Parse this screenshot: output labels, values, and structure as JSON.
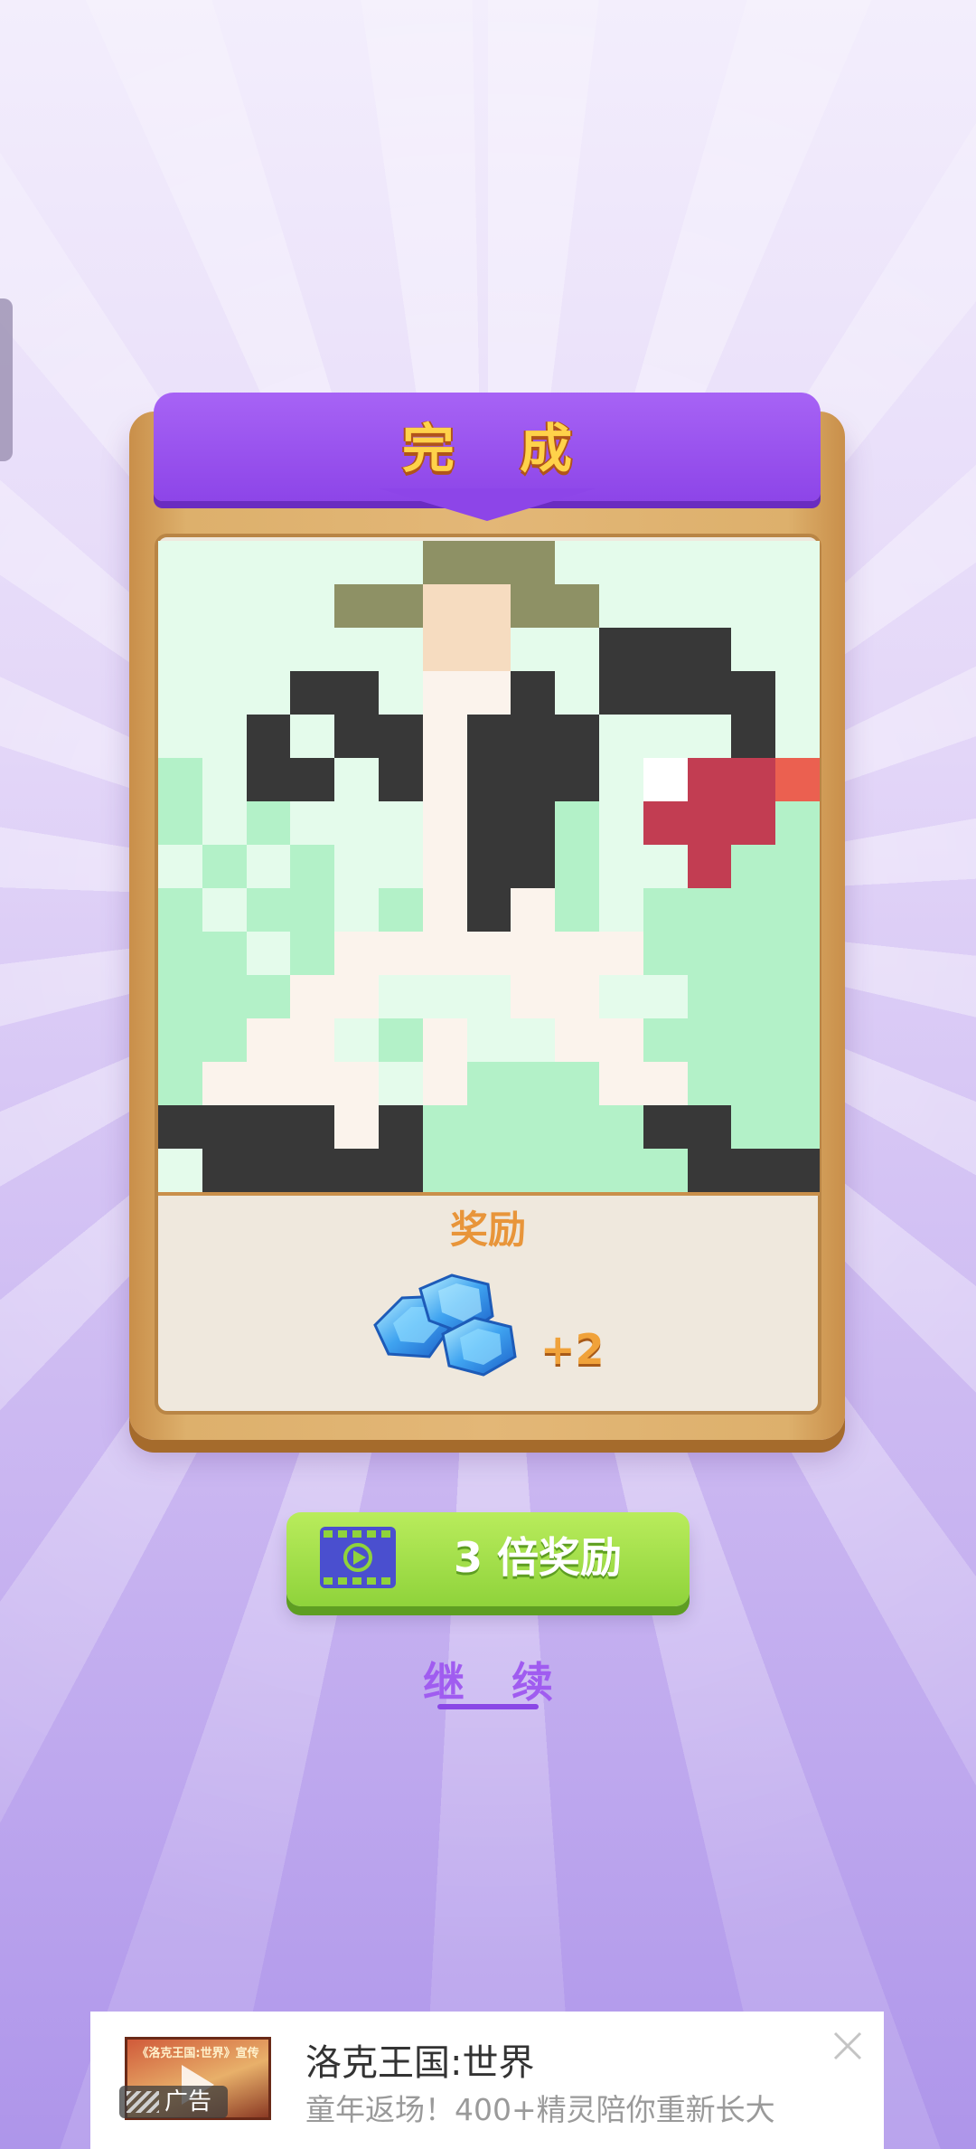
{
  "dialog": {
    "title": "完 成",
    "reward_label": "奖励",
    "reward_count": "+2"
  },
  "pixel_art": {
    "palette": {
      "0": "#e4fbeb",
      "1": "#b3f1c8",
      "2": "#383838",
      "3": "#fbf3ec",
      "4": "#8e9165",
      "5": "#f6dcc0",
      "6": "#c23d52",
      "7": "#eb6050",
      "8": "#ffffff"
    },
    "rows": [
      "000000444000000",
      "000044554400000",
      "000000550022200",
      "000220332022220",
      "002022322200020",
      "102202322208667",
      "101000322106661",
      "010100322100611",
      "101101323101111",
      "110133333331111",
      "111330003300111",
      "113301300331111",
      "133330311133111",
      "222232111112211",
      "022222111111222"
    ]
  },
  "buttons": {
    "triple_reward": "3 倍奖励",
    "continue": "继 续"
  },
  "ad": {
    "thumb_caption": "《洛克王国:世界》宣传",
    "tag": "广告",
    "title": "洛克王国:世界",
    "description": "童年返场！400+精灵陪你重新长大"
  }
}
